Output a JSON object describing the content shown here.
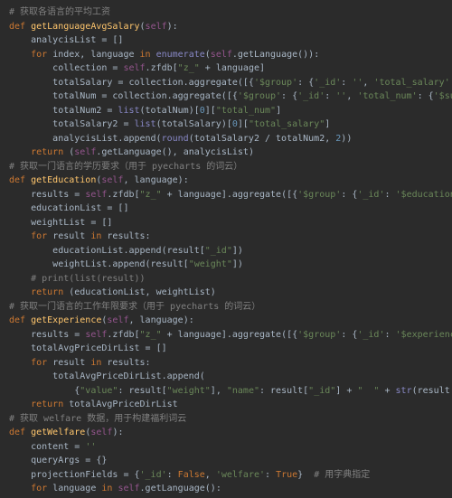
{
  "theme": {
    "background": "#2b2b2b",
    "foreground": "#a9b7c6",
    "keyword": "#cc7832",
    "function": "#ffc66d",
    "param": "#94558d",
    "string": "#6a8759",
    "number": "#6897bb",
    "comment": "#808080",
    "builtin": "#8888c6"
  },
  "code": {
    "functions": [
      {
        "name": "getLanguageAvgSalary",
        "params": [
          "self"
        ],
        "comment": "# 获取各语言的平均工资"
      },
      {
        "name": "getEducation",
        "params": [
          "self",
          "language"
        ],
        "comment": "# 获取一门语言的学历要求（用于 pyecharts 的词云）"
      },
      {
        "name": "getExperience",
        "params": [
          "self",
          "language"
        ],
        "comment": "# 获取一门语言的工作年限要求（用于 pyecharts 的词云）"
      },
      {
        "name": "getWelfare",
        "params": [
          "self"
        ],
        "comment": "# 获取 welfare 数据，用于构建福利词云"
      }
    ],
    "lines": [
      {
        "indent": 0,
        "tokens": [
          {
            "t": "cm",
            "v": "# 获取各语言的平均工资"
          }
        ]
      },
      {
        "indent": 0,
        "tokens": [
          {
            "t": "kw",
            "v": "def "
          },
          {
            "t": "fn",
            "v": "getLanguageAvgSalary"
          },
          {
            "t": "punc",
            "v": "("
          },
          {
            "t": "param",
            "v": "self"
          },
          {
            "t": "punc",
            "v": "):"
          }
        ]
      },
      {
        "indent": 1,
        "tokens": [
          {
            "t": "punc",
            "v": "analycisList = []"
          }
        ]
      },
      {
        "indent": 1,
        "tokens": [
          {
            "t": "kw",
            "v": "for "
          },
          {
            "t": "punc",
            "v": "index, language "
          },
          {
            "t": "kw",
            "v": "in "
          },
          {
            "t": "builtin",
            "v": "enumerate"
          },
          {
            "t": "punc",
            "v": "("
          },
          {
            "t": "param",
            "v": "self"
          },
          {
            "t": "punc",
            "v": ".getLanguage()):"
          }
        ]
      },
      {
        "indent": 2,
        "tokens": [
          {
            "t": "punc",
            "v": "collection = "
          },
          {
            "t": "param",
            "v": "self"
          },
          {
            "t": "punc",
            "v": ".zfdb["
          },
          {
            "t": "str",
            "v": "\"z_\""
          },
          {
            "t": "punc",
            "v": " + language]"
          }
        ]
      },
      {
        "indent": 2,
        "tokens": [
          {
            "t": "punc",
            "v": "totalSalary = collection.aggregate([{"
          },
          {
            "t": "str",
            "v": "'$group'"
          },
          {
            "t": "punc",
            "v": ": {"
          },
          {
            "t": "str",
            "v": "'_id'"
          },
          {
            "t": "punc",
            "v": ": "
          },
          {
            "t": "str",
            "v": "''"
          },
          {
            "t": "punc",
            "v": ", "
          },
          {
            "t": "str",
            "v": "'total_salary'"
          },
          {
            "t": "punc",
            "v": ":"
          }
        ]
      },
      {
        "indent": 2,
        "tokens": [
          {
            "t": "punc",
            "v": "totalNum = collection.aggregate([{"
          },
          {
            "t": "str",
            "v": "'$group'"
          },
          {
            "t": "punc",
            "v": ": {"
          },
          {
            "t": "str",
            "v": "'_id'"
          },
          {
            "t": "punc",
            "v": ": "
          },
          {
            "t": "str",
            "v": "''"
          },
          {
            "t": "punc",
            "v": ", "
          },
          {
            "t": "str",
            "v": "'total_num'"
          },
          {
            "t": "punc",
            "v": ": {"
          },
          {
            "t": "str",
            "v": "'$sum"
          }
        ]
      },
      {
        "indent": 2,
        "tokens": [
          {
            "t": "punc",
            "v": "totalNum2 = "
          },
          {
            "t": "builtin",
            "v": "list"
          },
          {
            "t": "punc",
            "v": "(totalNum)["
          },
          {
            "t": "num",
            "v": "0"
          },
          {
            "t": "punc",
            "v": "]["
          },
          {
            "t": "str",
            "v": "\"total_num\""
          },
          {
            "t": "punc",
            "v": "]"
          }
        ]
      },
      {
        "indent": 2,
        "tokens": [
          {
            "t": "punc",
            "v": "totalSalary2 = "
          },
          {
            "t": "builtin",
            "v": "list"
          },
          {
            "t": "punc",
            "v": "(totalSalary)["
          },
          {
            "t": "num",
            "v": "0"
          },
          {
            "t": "punc",
            "v": "]["
          },
          {
            "t": "str",
            "v": "\"total_salary\""
          },
          {
            "t": "punc",
            "v": "]"
          }
        ]
      },
      {
        "indent": 2,
        "tokens": [
          {
            "t": "punc",
            "v": "analycisList.append("
          },
          {
            "t": "builtin",
            "v": "round"
          },
          {
            "t": "punc",
            "v": "(totalSalary2 / totalNum2, "
          },
          {
            "t": "num",
            "v": "2"
          },
          {
            "t": "punc",
            "v": "))"
          }
        ]
      },
      {
        "indent": 1,
        "tokens": [
          {
            "t": "kw",
            "v": "return "
          },
          {
            "t": "punc",
            "v": "("
          },
          {
            "t": "param",
            "v": "self"
          },
          {
            "t": "punc",
            "v": ".getLanguage(), analycisList)"
          }
        ]
      },
      {
        "indent": 0,
        "tokens": [
          {
            "t": "punc",
            "v": ""
          }
        ]
      },
      {
        "indent": 0,
        "tokens": [
          {
            "t": "cm",
            "v": "# 获取一门语言的学历要求（用于 pyecharts 的词云）"
          }
        ]
      },
      {
        "indent": 0,
        "tokens": [
          {
            "t": "kw",
            "v": "def "
          },
          {
            "t": "fn",
            "v": "getEducation"
          },
          {
            "t": "punc",
            "v": "("
          },
          {
            "t": "param",
            "v": "self"
          },
          {
            "t": "punc",
            "v": ", language):"
          }
        ]
      },
      {
        "indent": 1,
        "tokens": [
          {
            "t": "punc",
            "v": "results = "
          },
          {
            "t": "param",
            "v": "self"
          },
          {
            "t": "punc",
            "v": ".zfdb["
          },
          {
            "t": "str",
            "v": "\"z_\""
          },
          {
            "t": "punc",
            "v": " + language].aggregate([{"
          },
          {
            "t": "str",
            "v": "'$group'"
          },
          {
            "t": "punc",
            "v": ": {"
          },
          {
            "t": "str",
            "v": "'_id'"
          },
          {
            "t": "punc",
            "v": ": "
          },
          {
            "t": "str",
            "v": "'$education"
          }
        ]
      },
      {
        "indent": 1,
        "tokens": [
          {
            "t": "punc",
            "v": "educationList = []"
          }
        ]
      },
      {
        "indent": 1,
        "tokens": [
          {
            "t": "punc",
            "v": "weightList = []"
          }
        ]
      },
      {
        "indent": 1,
        "tokens": [
          {
            "t": "kw",
            "v": "for "
          },
          {
            "t": "punc",
            "v": "result "
          },
          {
            "t": "kw",
            "v": "in "
          },
          {
            "t": "punc",
            "v": "results:"
          }
        ]
      },
      {
        "indent": 2,
        "tokens": [
          {
            "t": "punc",
            "v": "educationList.append(result["
          },
          {
            "t": "str",
            "v": "\"_id\""
          },
          {
            "t": "punc",
            "v": "])"
          }
        ]
      },
      {
        "indent": 2,
        "tokens": [
          {
            "t": "punc",
            "v": "weightList.append(result["
          },
          {
            "t": "str",
            "v": "\"weight\""
          },
          {
            "t": "punc",
            "v": "])"
          }
        ]
      },
      {
        "indent": 1,
        "tokens": [
          {
            "t": "cm",
            "v": "# print(list(result))"
          }
        ]
      },
      {
        "indent": 1,
        "tokens": [
          {
            "t": "kw",
            "v": "return "
          },
          {
            "t": "punc",
            "v": "(educationList, weightList)"
          }
        ]
      },
      {
        "indent": 0,
        "tokens": [
          {
            "t": "punc",
            "v": ""
          }
        ]
      },
      {
        "indent": 0,
        "tokens": [
          {
            "t": "cm",
            "v": "# 获取一门语言的工作年限要求（用于 pyecharts 的词云）"
          }
        ]
      },
      {
        "indent": 0,
        "tokens": [
          {
            "t": "kw",
            "v": "def "
          },
          {
            "t": "fn",
            "v": "getExperience"
          },
          {
            "t": "punc",
            "v": "("
          },
          {
            "t": "param",
            "v": "self"
          },
          {
            "t": "punc",
            "v": ", language):"
          }
        ]
      },
      {
        "indent": 1,
        "tokens": [
          {
            "t": "punc",
            "v": "results = "
          },
          {
            "t": "param",
            "v": "self"
          },
          {
            "t": "punc",
            "v": ".zfdb["
          },
          {
            "t": "str",
            "v": "\"z_\""
          },
          {
            "t": "punc",
            "v": " + language].aggregate([{"
          },
          {
            "t": "str",
            "v": "'$group'"
          },
          {
            "t": "punc",
            "v": ": {"
          },
          {
            "t": "str",
            "v": "'_id'"
          },
          {
            "t": "punc",
            "v": ": "
          },
          {
            "t": "str",
            "v": "'$experience"
          }
        ]
      },
      {
        "indent": 1,
        "tokens": [
          {
            "t": "punc",
            "v": "totalAvgPriceDirList = []"
          }
        ]
      },
      {
        "indent": 1,
        "tokens": [
          {
            "t": "kw",
            "v": "for "
          },
          {
            "t": "punc",
            "v": "result "
          },
          {
            "t": "kw",
            "v": "in "
          },
          {
            "t": "punc",
            "v": "results:"
          }
        ]
      },
      {
        "indent": 2,
        "tokens": [
          {
            "t": "punc",
            "v": "totalAvgPriceDirList.append("
          }
        ]
      },
      {
        "indent": 3,
        "tokens": [
          {
            "t": "punc",
            "v": "{"
          },
          {
            "t": "str",
            "v": "\"value\""
          },
          {
            "t": "punc",
            "v": ": result["
          },
          {
            "t": "str",
            "v": "\"weight\""
          },
          {
            "t": "punc",
            "v": "], "
          },
          {
            "t": "str",
            "v": "\"name\""
          },
          {
            "t": "punc",
            "v": ": result["
          },
          {
            "t": "str",
            "v": "\"_id\""
          },
          {
            "t": "punc",
            "v": "] + "
          },
          {
            "t": "str",
            "v": "\"  \""
          },
          {
            "t": "punc",
            "v": " + "
          },
          {
            "t": "builtin",
            "v": "str"
          },
          {
            "t": "punc",
            "v": "(result["
          }
        ]
      },
      {
        "indent": 1,
        "tokens": [
          {
            "t": "kw",
            "v": "return "
          },
          {
            "t": "punc",
            "v": "totalAvgPriceDirList"
          }
        ]
      },
      {
        "indent": 0,
        "tokens": [
          {
            "t": "punc",
            "v": ""
          }
        ]
      },
      {
        "indent": 0,
        "tokens": [
          {
            "t": "cm",
            "v": "# 获取 welfare 数据，用于构建福利词云"
          }
        ]
      },
      {
        "indent": 0,
        "tokens": [
          {
            "t": "kw",
            "v": "def "
          },
          {
            "t": "fn",
            "v": "getWelfare"
          },
          {
            "t": "punc",
            "v": "("
          },
          {
            "t": "param",
            "v": "self"
          },
          {
            "t": "punc",
            "v": "):"
          }
        ]
      },
      {
        "indent": 1,
        "tokens": [
          {
            "t": "punc",
            "v": "content = "
          },
          {
            "t": "str",
            "v": "''"
          }
        ]
      },
      {
        "indent": 1,
        "tokens": [
          {
            "t": "punc",
            "v": "queryArgs = {}"
          }
        ]
      },
      {
        "indent": 1,
        "tokens": [
          {
            "t": "punc",
            "v": "projectionFields = {"
          },
          {
            "t": "str",
            "v": "'_id'"
          },
          {
            "t": "punc",
            "v": ": "
          },
          {
            "t": "bool",
            "v": "False"
          },
          {
            "t": "punc",
            "v": ", "
          },
          {
            "t": "str",
            "v": "'welfare'"
          },
          {
            "t": "punc",
            "v": ": "
          },
          {
            "t": "bool",
            "v": "True"
          },
          {
            "t": "punc",
            "v": "}  "
          },
          {
            "t": "cm",
            "v": "# 用字典指定"
          }
        ]
      },
      {
        "indent": 1,
        "tokens": [
          {
            "t": "kw",
            "v": "for "
          },
          {
            "t": "punc",
            "v": "language "
          },
          {
            "t": "kw",
            "v": "in "
          },
          {
            "t": "param",
            "v": "self"
          },
          {
            "t": "punc",
            "v": ".getLanguage():"
          }
        ]
      }
    ]
  }
}
